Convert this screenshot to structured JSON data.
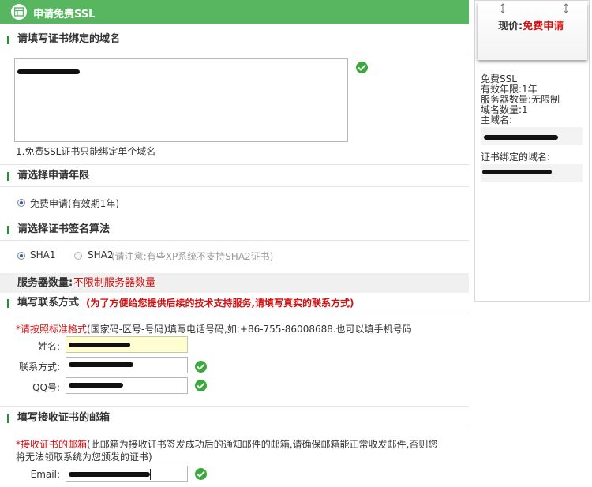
{
  "header": {
    "title": "申请免费SSL"
  },
  "domain_section": {
    "title": "请填写证书绑定的域名",
    "note": "1.免费SSL证书只能绑定单个域名"
  },
  "period_section": {
    "title": "请选择申请年限",
    "option_label": "免费申请(有效期1年)"
  },
  "algo_section": {
    "title": "请选择证书签名算法",
    "sha1_label": "SHA1",
    "sha2_label": "SHA2",
    "sha2_note": "(请注意:有些XP系统不支持SHA2证书)"
  },
  "servers": {
    "label": "服务器数量:",
    "value": "不限制服务器数量"
  },
  "contact_section": {
    "title": "填写联系方式",
    "title_note": "(为了方便给您提供后续的技术支持服务,请填写真实的联系方式)",
    "hint_star": "*请按照标准格式",
    "hint_rest": "(国家码-区号-号码)填写电话号码,如:+86-755-86008688.也可以填手机号码",
    "name_label": "姓名:",
    "phone_label": "联系方式:",
    "qq_label": "QQ号:"
  },
  "email_section": {
    "title": "填写接收证书的邮箱",
    "hint_star": "*接收证书的邮箱",
    "hint_line1": "(此邮箱为接收证书签发成功后的通知邮件的邮箱,请确保邮箱能正常收发邮件,否则您",
    "hint_line2": "将无法领取系统为您颁发的证书)",
    "email_label": "Email:"
  },
  "sidebar": {
    "price_label": "现价:",
    "price_value": "免费申请",
    "product": "免费SSL",
    "validity": "有效年限:1年",
    "server_count": "服务器数量:无限制",
    "domain_count": "域名数量:1",
    "main_domain_label": "主域名:",
    "bound_domain_label": "证书绑定的域名:"
  },
  "colors": {
    "header_green": "#58b560",
    "accent_red": "#d11111",
    "check_green": "#3aa93c"
  }
}
